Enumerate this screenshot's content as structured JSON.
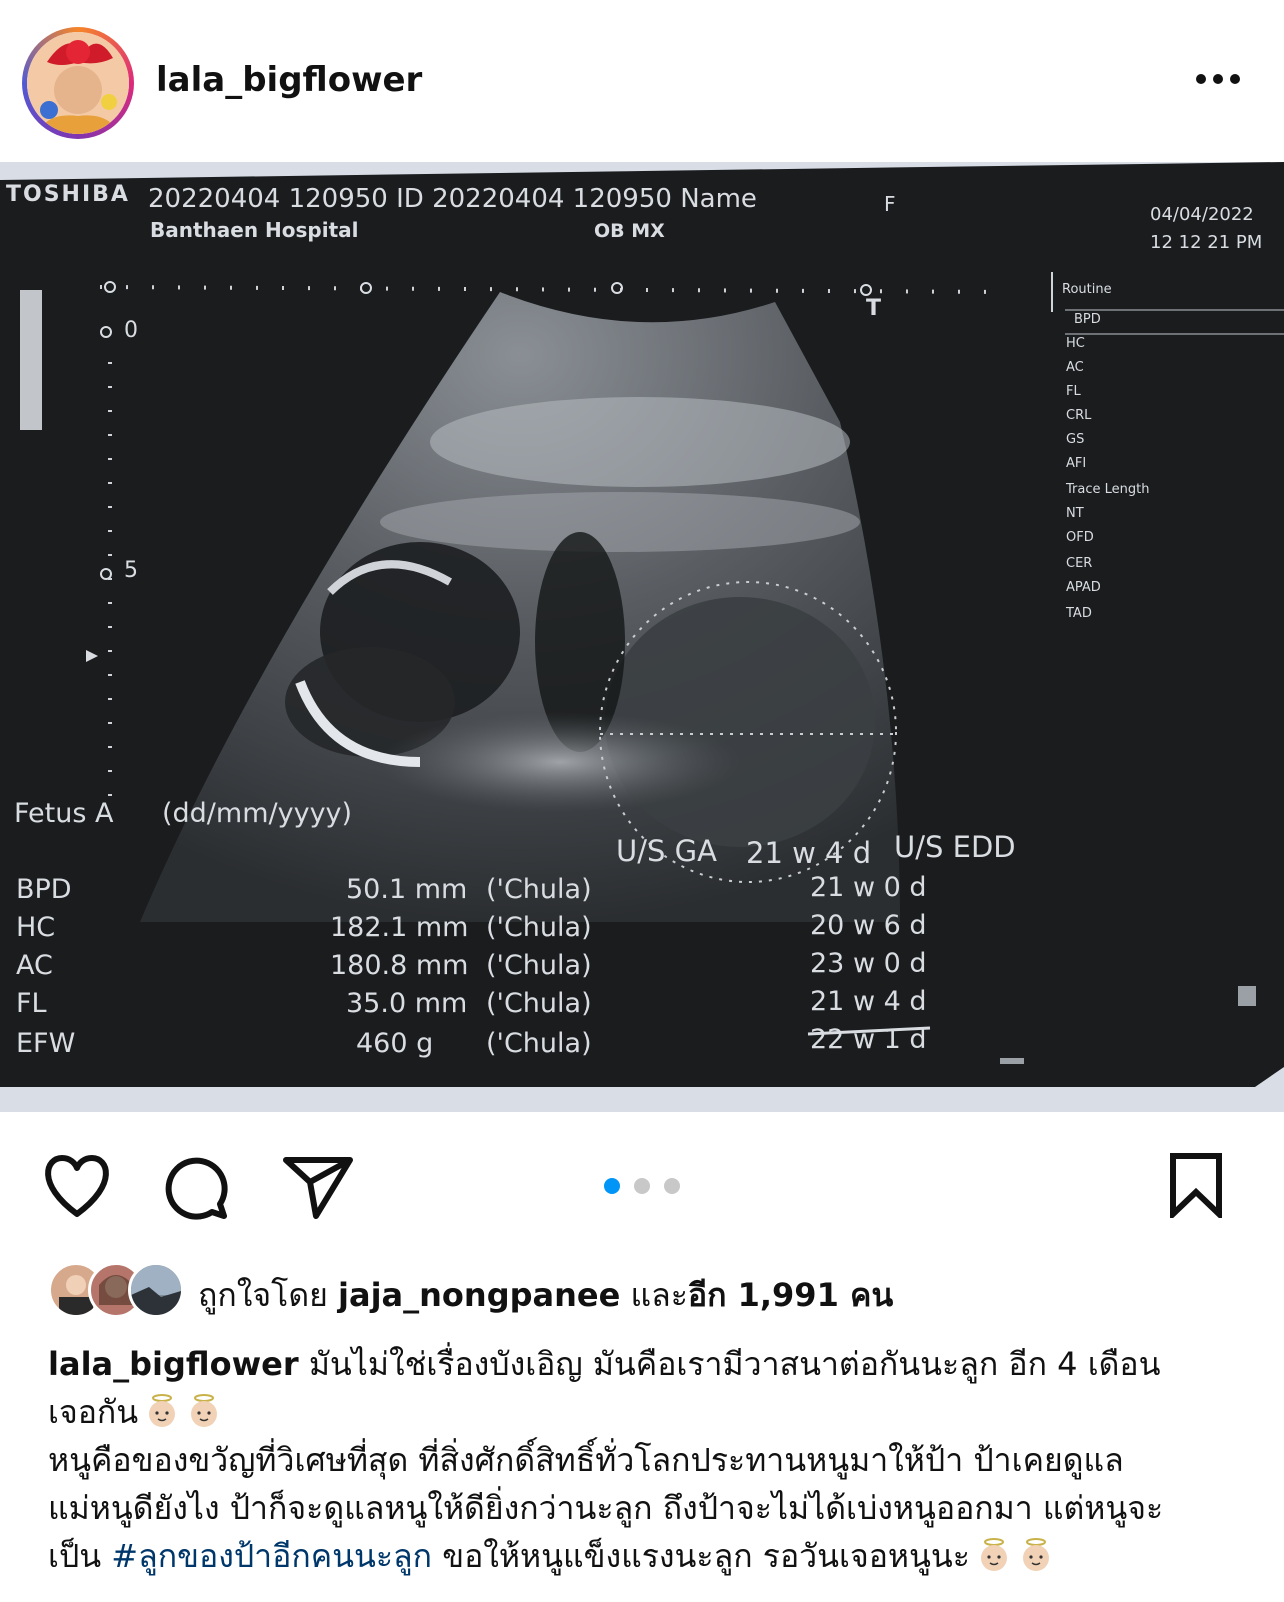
{
  "post": {
    "username": "lala_bigflower",
    "more_icon": "more-horizontal-icon"
  },
  "scan": {
    "brand": "TOSHIBA",
    "header_line": "20220404 120950 ID 20220404 120950 Name",
    "header_sex": "F",
    "hospital": "Banthaen Hospital",
    "mode": "OB MX",
    "date": "04/04/2022",
    "time": "12 12 21 PM",
    "scale_0": "0",
    "scale_5": "5",
    "marker_t": "T",
    "menu_title": "Routine",
    "menu": [
      "BPD",
      "HC",
      "AC",
      "FL",
      "CRL",
      "GS",
      "AFI",
      "Trace Length",
      "NT",
      "OFD",
      "CER",
      "APAD",
      "TAD"
    ],
    "fetus_label": "Fetus A",
    "date_format": "(dd/mm/yyyy)",
    "ga_label": "U/S GA",
    "ga_value": "21 w 4 d",
    "edd_label": "U/S EDD",
    "rows": [
      {
        "name": "BPD",
        "value": "50.1 mm",
        "ref": "('Chula)",
        "age": "21 w 0 d"
      },
      {
        "name": "HC",
        "value": "182.1 mm",
        "ref": "('Chula)",
        "age": "20 w 6 d"
      },
      {
        "name": "AC",
        "value": "180.8 mm",
        "ref": "('Chula)",
        "age": "23 w 0 d"
      },
      {
        "name": "FL",
        "value": "35.0 mm",
        "ref": "('Chula)",
        "age": "21 w 4 d"
      },
      {
        "name": "EFW",
        "value": "460 g",
        "ref": "('Chula)",
        "age": "22 w 1 d"
      }
    ]
  },
  "actions": {
    "like_icon": "heart-icon",
    "comment_icon": "comment-icon",
    "share_icon": "send-icon",
    "save_icon": "bookmark-icon",
    "carousel_count": 3,
    "carousel_active": 1,
    "accent": "#0095f6"
  },
  "likes": {
    "prefix": "ถูกใจโดย",
    "user": "jaja_nongpanee",
    "middle": "และ",
    "count": "อีก 1,991 คน"
  },
  "caption": {
    "username": "lala_bigflower",
    "line1": "มันไม่ใช่เรื่องบังเอิญ มันคือเรามีวาสนาต่อกันนะลูก อีก 4 เดือน",
    "line2": "เจอกัน",
    "line3": "หนูคือของขวัญที่วิเศษที่สุด ที่สิ่งศักดิ์สิทธิ์ทั่วโลกประทานหนูมาให้ป้า ป้าเคยดูแล",
    "line4": "แม่หนูดียังไง ป้าก็จะดูแลหนูให้ดียิ่งกว่านะลูก ถึงป้าจะไม่ได้เบ่งหนูออกมา แต่หนูจะ",
    "line5_prefix": "เป็น",
    "hashtag": "#ลูกของป้าอีกคนนะลูก",
    "line5_suffix": "ขอให้หนูแข็งแรงนะลูก รอวันเจอหนูนะ",
    "emoji": "baby-angel-emoji",
    "hashtag_color": "#00376b"
  }
}
